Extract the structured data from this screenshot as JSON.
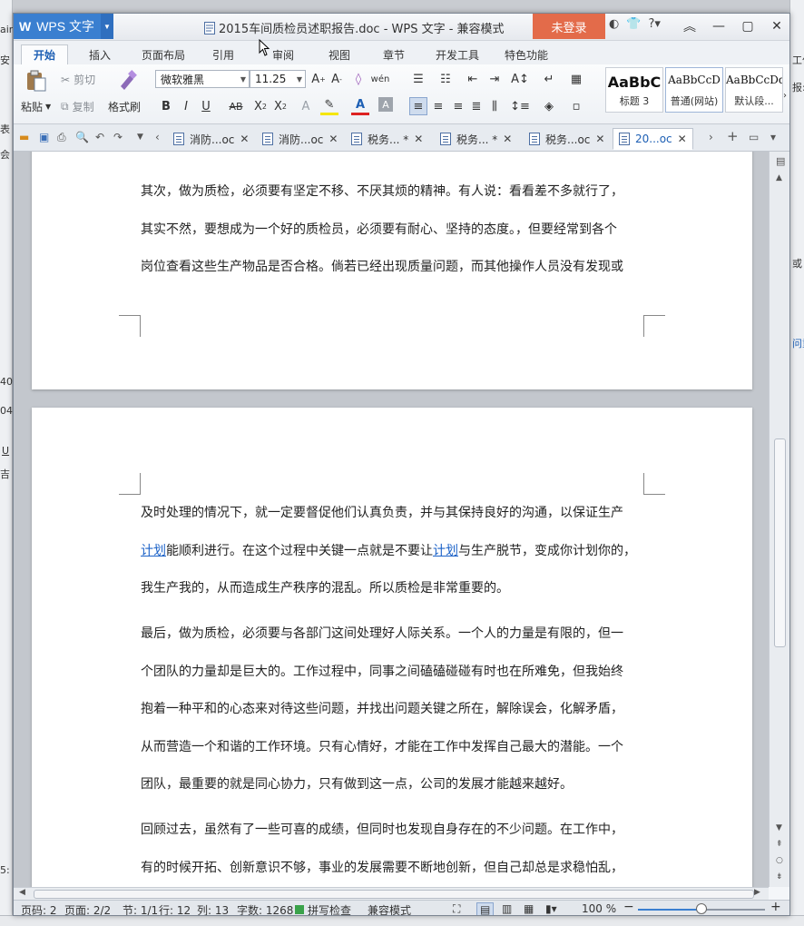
{
  "window": {
    "app_name": "WPS 文字",
    "title": "2015车间质检员述职报告.doc - WPS 文字 - 兼容模式",
    "login_label": "未登录"
  },
  "background_app": {
    "left_texts": [
      "ain",
      "安",
      "表",
      "会",
      "40",
      "04",
      "U",
      "吉",
      "5:"
    ],
    "right_texts": [
      "工作",
      "报:",
      "或",
      "问重"
    ]
  },
  "ribbon_tabs": [
    "开始",
    "插入",
    "页面布局",
    "引用",
    "审阅",
    "视图",
    "章节",
    "开发工具",
    "特色功能"
  ],
  "ribbon": {
    "paste": "粘贴",
    "cut": "剪切",
    "copy": "复制",
    "format_painter": "格式刷",
    "font_name": "微软雅黑",
    "font_size": "11.25",
    "styles": [
      {
        "preview": "AaBbC",
        "name": "标题 3"
      },
      {
        "preview": "AaBbCcD",
        "name": "普通(网站)"
      },
      {
        "preview": "AaBbCcDd",
        "name": "默认段..."
      }
    ]
  },
  "doc_tabs": [
    {
      "label": "消防...oc"
    },
    {
      "label": "消防...oc"
    },
    {
      "label": "税务... *"
    },
    {
      "label": "税务... *"
    },
    {
      "label": "税务...oc"
    },
    {
      "label": "20...oc"
    }
  ],
  "document": {
    "page1_lines": [
      "其次，做为质检，必须要有坚定不移、不厌其烦的精神。有人说：看看差不多就行了，",
      "其实不然，要想成为一个好的质检员，必须要有耐心、坚持的态度。，但要经常到各个",
      "岗位查看这些生产物品是否合格。倘若已经出现质量问题，而其他操作人员没有发现或"
    ],
    "p2_line1": "及时处理的情况下，就一定要督促他们认真负责，并与其保持良好的沟通，以保证生产",
    "p2_link1": "计划",
    "p2_line2_mid": "能顺利进行。在这个过程中关键一点就是不要让",
    "p2_link2": "计划",
    "p2_line2_end": "与生产脱节，变成你计划你的，",
    "p2_line3": "我生产我的，从而造成生产秩序的混乱。所以质检是非常重要的。",
    "para3_lines": [
      "最后，做为质检，必须要与各部门这间处理好人际关系。一个人的力量是有限的，但一",
      "个团队的力量却是巨大的。工作过程中，同事之间磕磕碰碰有时也在所难免，但我始终",
      "抱着一种平和的心态来对待这些问题，并找出问题关键之所在，解除误会，化解矛盾，",
      "从而营造一个和谐的工作环境。只有心情好，才能在工作中发挥自己最大的潜能。一个",
      "团队，最重要的就是同心协力，只有做到这一点，公司的发展才能越来越好。"
    ],
    "para4_lines": [
      "回顾过去，虽然有了一些可喜的成绩，但同时也发现自身存在的不少问题。在工作中，",
      "有的时候开拓、创新意识不够，事业的发展需要不断地创新，但自己却总是求稳怕乱，"
    ]
  },
  "status": {
    "page_code": "页码: 2",
    "pages": "页面: 2/2",
    "section": "节: 1/1",
    "row": "行: 12",
    "col": "列: 13",
    "words": "字数: 1268",
    "spell": "拼写检查",
    "mode": "兼容模式",
    "zoom": "100 %",
    "zoom_level": 0.5
  }
}
